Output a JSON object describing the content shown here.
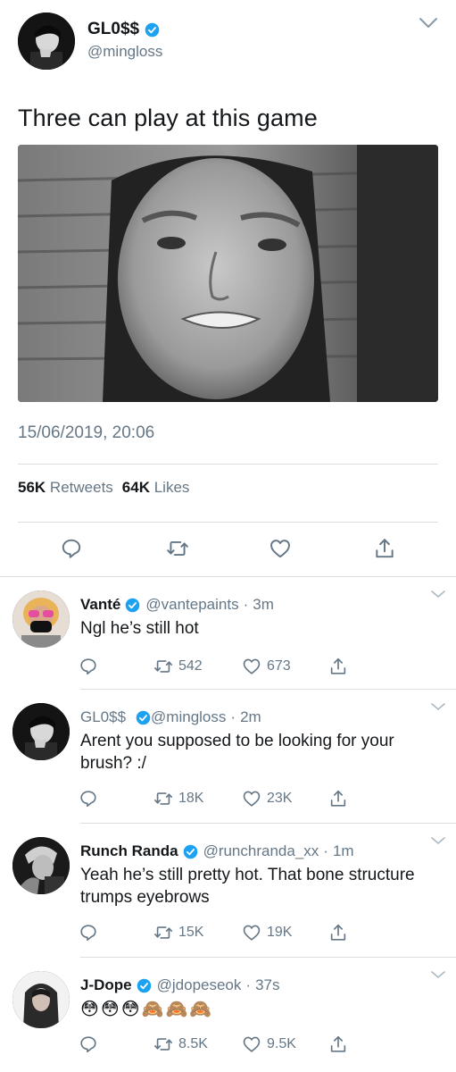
{
  "main": {
    "name": "GL0$$",
    "handle": "@mingloss",
    "text": "Three can play at this game",
    "timestamp": "15/06/2019, 20:06",
    "retweets_count": "56K",
    "retweets_label": "Retweets",
    "likes_count": "64K",
    "likes_label": "Likes"
  },
  "replies": [
    {
      "name": "Vanté",
      "handle": "@vantepaints",
      "time": "3m",
      "text": "Ngl he’s still hot",
      "retweets": "542",
      "likes": "673"
    },
    {
      "name": "GL0$$",
      "handle": "@mingloss",
      "time": "2m",
      "text": "Arent you supposed to be looking for your brush? :/",
      "retweets": "18K",
      "likes": "23K"
    },
    {
      "name": "Runch Randa",
      "handle": "@runchranda_xx",
      "time": "1m",
      "text": "Yeah he’s still pretty hot. That bone structure trumps eyebrows",
      "retweets": "15K",
      "likes": "19K"
    },
    {
      "name": "J-Dope",
      "handle": "@jdopeseok",
      "time": "37s",
      "emojis": [
        "😳",
        "😳",
        "😳",
        "🙈",
        "🙈",
        "🙈"
      ],
      "retweets": "8.5K",
      "likes": "9.5K"
    }
  ],
  "colors": {
    "verified": "#1da1f2",
    "muted": "#657786",
    "text": "#14171a"
  },
  "icons": {
    "reply": "reply-icon",
    "retweet": "retweet-icon",
    "like": "heart-icon",
    "share": "share-icon",
    "verified": "verified-badge-icon",
    "chevron": "chevron-down-icon"
  }
}
